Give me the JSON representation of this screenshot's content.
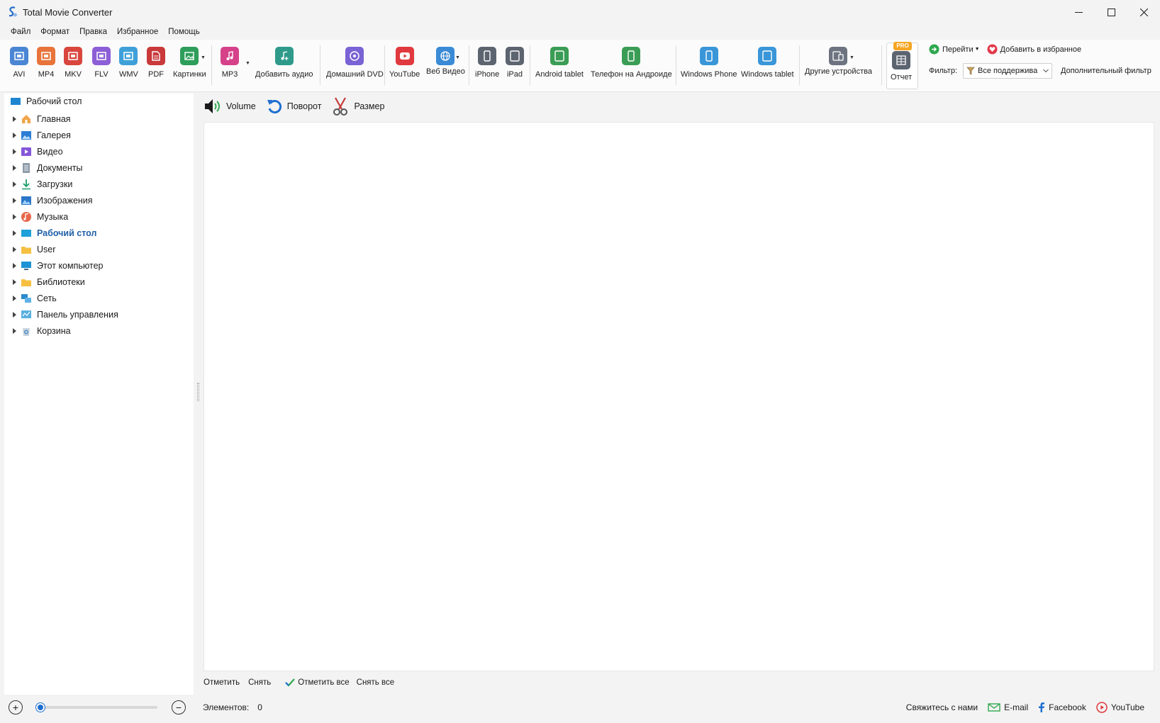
{
  "window": {
    "title": "Total Movie Converter"
  },
  "menu": [
    "Файл",
    "Формат",
    "Правка",
    "Избранное",
    "Помощь"
  ],
  "toolbar": {
    "formats": [
      "AVI",
      "MP4",
      "MKV",
      "FLV",
      "WMV",
      "PDF",
      "Картинки",
      "MP3"
    ],
    "add_audio": "Добавить аудио",
    "dvd": "Домашний DVD",
    "youtube": "YouTube",
    "web_video": "Веб Видео",
    "iphone": "iPhone",
    "ipad": "iPad",
    "android_tablet": "Android tablet",
    "android_phone": "Телефон на Андроиде",
    "windows_phone": "Windows Phone",
    "windows_tablet": "Windows tablet",
    "other_devices": "Другие устройства",
    "report": "Отчет",
    "pro_badge": "PRO",
    "goto": "Перейти",
    "add_favorite": "Добавить в избранное",
    "filter_label": "Фильтр:",
    "filter_value": "Все поддержива",
    "extra_filter": "Дополнительный фильтр"
  },
  "sidebar": {
    "root": "Рабочий стол",
    "items": [
      "Главная",
      "Галерея",
      "Видео",
      "Документы",
      "Загрузки",
      "Изображения",
      "Музыка",
      "Рабочий стол",
      "User",
      "Этот компьютер",
      "Библиотеки",
      "Сеть",
      "Панель управления",
      "Корзина"
    ]
  },
  "actions": {
    "volume": "Volume",
    "rotate": "Поворот",
    "resize": "Размер"
  },
  "selection": {
    "check": "Отметить",
    "uncheck": "Снять",
    "check_all": "Отметить все",
    "uncheck_all": "Снять все"
  },
  "status": {
    "items_label": "Элементов:",
    "items_count": "0",
    "zoom_level": 0.03,
    "contact": "Свяжитесь с нами",
    "email": "E-mail",
    "facebook": "Facebook",
    "youtube": "YouTube"
  },
  "colors": {
    "accent": "#1f6fd1",
    "active_text": "#1f5fa8",
    "pro": "#f6a623"
  }
}
